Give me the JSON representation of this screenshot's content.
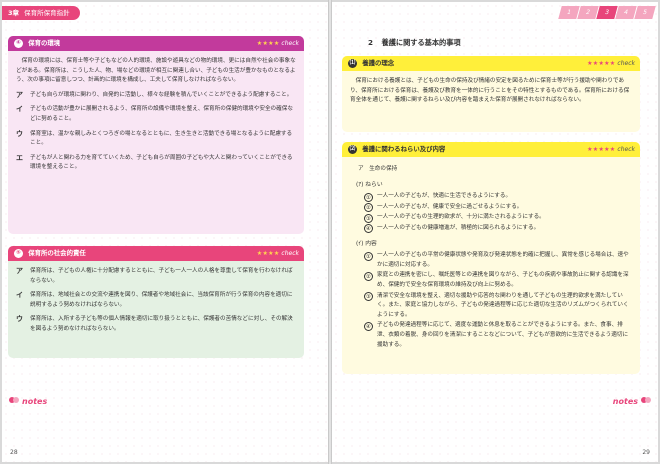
{
  "left": {
    "chapter": {
      "num": "3章",
      "title": "保育所保育指針"
    },
    "box4": {
      "num": "④",
      "title": "保育の環境",
      "stars": "★★★★",
      "check": "check",
      "intro": "保育の環境には、保育士等や子どもなどの人的環境、施設や遊具などの物的環境、更には自然や社会の事象などがある。保育所は、こうした人、物、場などの環境が相互に関連し合い、子どもの生活が豊かなものとなるよう、次の事項に留意しつつ、計画的に環境を構成し、工夫して保育しなければならない。",
      "items": [
        {
          "mark": "ア",
          "text": "子ども自らが環境に関わり、自発的に活動し、様々な経験を積んでいくことができるよう配慮すること。"
        },
        {
          "mark": "イ",
          "text": "子どもの活動が豊かに展開されるよう、保育所の設備や環境を整え、保育所の保健的環境や安全の確保などに努めること。"
        },
        {
          "mark": "ウ",
          "text": "保育室は、温かな親しみとくつろぎの場となるとともに、生き生きと活動できる場となるように配慮すること。"
        },
        {
          "mark": "エ",
          "text": "子どもが人と関わる力を育てていくため、子ども自らが周囲の子どもや大人と関わっていくことができる環境を整えること。"
        }
      ]
    },
    "box5": {
      "num": "⑤",
      "title": "保育所の社会的責任",
      "stars": "★★★★",
      "check": "check",
      "items": [
        {
          "mark": "ア",
          "text": "保育所は、子どもの人権に十分配慮するとともに、子ども一人一人の人格を尊重して保育を行わなければならない。"
        },
        {
          "mark": "イ",
          "text": "保育所は、地域社会との交流や連携を図り、保護者や地域社会に、当該保育所が行う保育の内容を適切に説明するよう努めなければならない。"
        },
        {
          "mark": "ウ",
          "text": "保育所は、入所する子ども等の個人情報を適切に取り扱うとともに、保護者の苦情などに対し、その解決を図るよう努めなければならない。"
        }
      ]
    },
    "notes": "notes",
    "page": "28"
  },
  "right": {
    "nav": [
      "1",
      "2",
      "3",
      "4",
      "5"
    ],
    "nav_active": "3",
    "section": {
      "no": "2",
      "title": "養護に関する基本的事項"
    },
    "box1": {
      "num": "⑴",
      "title": "養護の理念",
      "stars": "★★★★★",
      "check": "check",
      "text": "保育における養護とは、子どもの生命の保持及び情緒の安定を図るために保育士等が行う援助や関わりであり、保育所における保育は、養護及び教育を一体的に行うことをその特性とするものである。保育所における保育全体を通じて、養護に関するねらい及び内容を踏まえた保育が展開されなければならない。"
    },
    "box2": {
      "num": "⑵",
      "title": "養護に関わるねらい及び内容",
      "stars": "★★★★★",
      "check": "check",
      "sub_a": "ア　生命の保持",
      "aims_head": "(ｱ) ねらい",
      "aims": [
        {
          "n": "①",
          "t": "一人一人の子どもが、快適に生活できるようにする。"
        },
        {
          "n": "②",
          "t": "一人一人の子どもが、健康で安全に過ごせるようにする。"
        },
        {
          "n": "③",
          "t": "一人一人の子どもの生理的欲求が、十分に満たされるようにする。"
        },
        {
          "n": "④",
          "t": "一人一人の子どもの健康増進が、積極的に図られるようにする。"
        }
      ],
      "content_head": "(ｲ) 内容",
      "contents": [
        {
          "n": "①",
          "t": "一人一人の子どもの平常の健康状態や発育及び発達状態を的確に把握し、異常を感じる場合は、速やかに適切に対応する。"
        },
        {
          "n": "②",
          "t": "家庭との連携を密にし、嘱託医等との連携を図りながら、子どもの疾病や事故防止に関する認識を深め、保健的で安全な保育環境の維持及び向上に努める。"
        },
        {
          "n": "③",
          "t": "清潔で安全な環境を整え、適切な援助や応答的な関わりを通して子どもの生理的欲求を満たしていく。また、家庭と協力しながら、子どもの発達過程等に応じた適切な生活のリズムがつくられていくようにする。"
        },
        {
          "n": "④",
          "t": "子どもの発達過程等に応じて、適度な運動と休息を取ることができるようにする。また、食事、排泄、衣類の着脱、身の回りを清潔にすることなどについて、子どもが意欲的に生活できるよう適切に援助する。"
        }
      ]
    },
    "notes": "notes",
    "page": "29"
  },
  "colors": {
    "pink": "#e8457b",
    "purple": "#c23a9c",
    "yellow": "#ffef3a",
    "red_text": "#e0203a"
  }
}
